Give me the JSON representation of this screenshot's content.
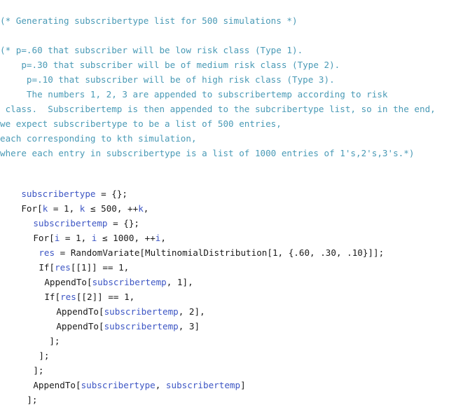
{
  "comment_block": [
    "(* Generating subscribertype list for 500 simulations *)",
    "(* p=.60 that subscriber will be low risk class (Type 1).",
    "    p=.30 that subscriber will be of medium risk class (Type 2).",
    "     p=.10 that subscriber will be of high risk class (Type 3).",
    "     The numbers 1, 2, 3 are appended to subscribertemp according to risk",
    " class.  Subscribertemp is then appended to the subcribertype list, so in the end,",
    "we expect subscribertype to be a list of 500 entries,",
    "each corresponding to kth simulation,",
    "where each entry in subscribertype is a list of 1000 entries of 1's,2's,3's.*)"
  ],
  "code": {
    "l1_var": "subscribertype",
    "l1_rest": " = {};",
    "l2_a": "For[",
    "l2_k1": "k",
    "l2_b": " = 1, ",
    "l2_k2": "k",
    "l2_c": " ≤ 500, ++",
    "l2_k3": "k",
    "l2_d": ",",
    "l3_var": "subscribertemp",
    "l3_rest": " = {};",
    "l4_a": "For[",
    "l4_i1": "i",
    "l4_b": " = 1, ",
    "l4_i2": "i",
    "l4_c": " ≤ 1000, ++",
    "l4_i3": "i",
    "l4_d": ",",
    "l5_var": "res",
    "l5_rest": " = RandomVariate[MultinomialDistribution[1, {.60, .30, .10}]];",
    "l6_a": "If[",
    "l6_var": "res",
    "l6_b": "[[1]] == 1,",
    "l7_a": "AppendTo[",
    "l7_var": "subscribertemp",
    "l7_b": ", 1],",
    "l8_a": "If[",
    "l8_var": "res",
    "l8_b": "[[2]] == 1,",
    "l9_a": "AppendTo[",
    "l9_var": "subscribertemp",
    "l9_b": ", 2],",
    "l10_a": "AppendTo[",
    "l10_var": "subscribertemp",
    "l10_b": ", 3]",
    "l11": "];",
    "l12": "];",
    "l13": "];",
    "l14_a": "AppendTo[",
    "l14_var1": "subscribertype",
    "l14_b": ", ",
    "l14_var2": "subscribertemp",
    "l14_c": "]",
    "l15": "];"
  }
}
